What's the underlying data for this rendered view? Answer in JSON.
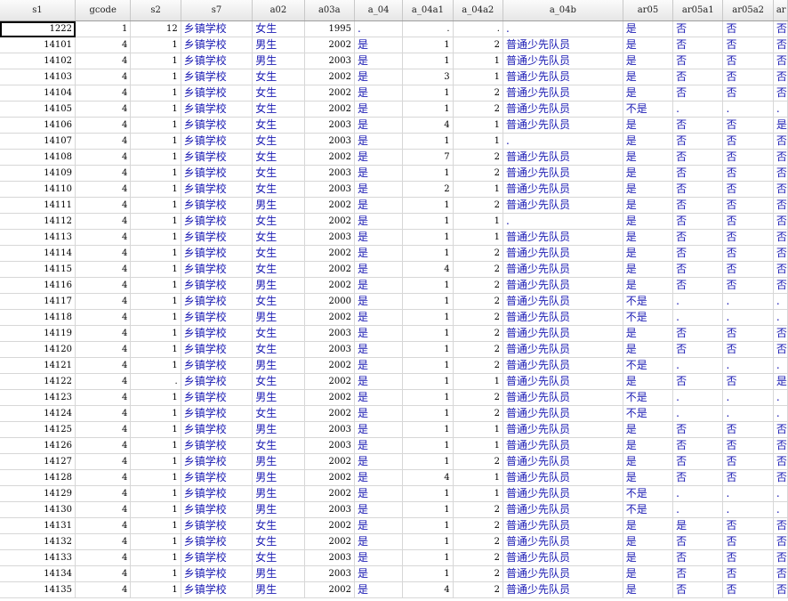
{
  "columns": [
    "s1",
    "gcode",
    "s2",
    "s7",
    "a02",
    "a03a",
    "a_04",
    "a_04a1",
    "a_04a2",
    "a_04b",
    "ar05",
    "ar05a1",
    "ar05a2",
    "ar"
  ],
  "rows": [
    [
      "1222",
      "1",
      "12",
      "乡镇学校",
      "女生",
      "1995",
      ".",
      ".",
      ".",
      ".",
      "是",
      "否",
      "否",
      "否"
    ],
    [
      "14101",
      "4",
      "1",
      "乡镇学校",
      "男生",
      "2002",
      "是",
      "1",
      "2",
      "普通少先队员",
      "是",
      "否",
      "否",
      "否"
    ],
    [
      "14102",
      "4",
      "1",
      "乡镇学校",
      "男生",
      "2003",
      "是",
      "1",
      "1",
      "普通少先队员",
      "是",
      "否",
      "否",
      "否"
    ],
    [
      "14103",
      "4",
      "1",
      "乡镇学校",
      "女生",
      "2002",
      "是",
      "3",
      "1",
      "普通少先队员",
      "是",
      "否",
      "否",
      "否"
    ],
    [
      "14104",
      "4",
      "1",
      "乡镇学校",
      "女生",
      "2002",
      "是",
      "1",
      "2",
      "普通少先队员",
      "是",
      "否",
      "否",
      "否"
    ],
    [
      "14105",
      "4",
      "1",
      "乡镇学校",
      "女生",
      "2002",
      "是",
      "1",
      "2",
      "普通少先队员",
      "不是",
      ".",
      ".",
      "."
    ],
    [
      "14106",
      "4",
      "1",
      "乡镇学校",
      "女生",
      "2003",
      "是",
      "4",
      "1",
      "普通少先队员",
      "是",
      "否",
      "否",
      "是"
    ],
    [
      "14107",
      "4",
      "1",
      "乡镇学校",
      "女生",
      "2003",
      "是",
      "1",
      "1",
      ".",
      "是",
      "否",
      "否",
      "否"
    ],
    [
      "14108",
      "4",
      "1",
      "乡镇学校",
      "女生",
      "2002",
      "是",
      "7",
      "2",
      "普通少先队员",
      "是",
      "否",
      "否",
      "否"
    ],
    [
      "14109",
      "4",
      "1",
      "乡镇学校",
      "女生",
      "2003",
      "是",
      "1",
      "2",
      "普通少先队员",
      "是",
      "否",
      "否",
      "否"
    ],
    [
      "14110",
      "4",
      "1",
      "乡镇学校",
      "女生",
      "2003",
      "是",
      "2",
      "1",
      "普通少先队员",
      "是",
      "否",
      "否",
      "否"
    ],
    [
      "14111",
      "4",
      "1",
      "乡镇学校",
      "男生",
      "2002",
      "是",
      "1",
      "2",
      "普通少先队员",
      "是",
      "否",
      "否",
      "否"
    ],
    [
      "14112",
      "4",
      "1",
      "乡镇学校",
      "女生",
      "2002",
      "是",
      "1",
      "1",
      ".",
      "是",
      "否",
      "否",
      "否"
    ],
    [
      "14113",
      "4",
      "1",
      "乡镇学校",
      "女生",
      "2003",
      "是",
      "1",
      "1",
      "普通少先队员",
      "是",
      "否",
      "否",
      "否"
    ],
    [
      "14114",
      "4",
      "1",
      "乡镇学校",
      "女生",
      "2002",
      "是",
      "1",
      "2",
      "普通少先队员",
      "是",
      "否",
      "否",
      "否"
    ],
    [
      "14115",
      "4",
      "1",
      "乡镇学校",
      "女生",
      "2002",
      "是",
      "4",
      "2",
      "普通少先队员",
      "是",
      "否",
      "否",
      "否"
    ],
    [
      "14116",
      "4",
      "1",
      "乡镇学校",
      "男生",
      "2002",
      "是",
      "1",
      "2",
      "普通少先队员",
      "是",
      "否",
      "否",
      "否"
    ],
    [
      "14117",
      "4",
      "1",
      "乡镇学校",
      "女生",
      "2000",
      "是",
      "1",
      "2",
      "普通少先队员",
      "不是",
      ".",
      ".",
      "."
    ],
    [
      "14118",
      "4",
      "1",
      "乡镇学校",
      "男生",
      "2002",
      "是",
      "1",
      "2",
      "普通少先队员",
      "不是",
      ".",
      ".",
      "."
    ],
    [
      "14119",
      "4",
      "1",
      "乡镇学校",
      "女生",
      "2003",
      "是",
      "1",
      "2",
      "普通少先队员",
      "是",
      "否",
      "否",
      "否"
    ],
    [
      "14120",
      "4",
      "1",
      "乡镇学校",
      "女生",
      "2003",
      "是",
      "1",
      "2",
      "普通少先队员",
      "是",
      "否",
      "否",
      "否"
    ],
    [
      "14121",
      "4",
      "1",
      "乡镇学校",
      "男生",
      "2002",
      "是",
      "1",
      "2",
      "普通少先队员",
      "不是",
      ".",
      ".",
      "."
    ],
    [
      "14122",
      "4",
      ".",
      "乡镇学校",
      "女生",
      "2002",
      "是",
      "1",
      "1",
      "普通少先队员",
      "是",
      "否",
      "否",
      "是"
    ],
    [
      "14123",
      "4",
      "1",
      "乡镇学校",
      "男生",
      "2002",
      "是",
      "1",
      "2",
      "普通少先队员",
      "不是",
      ".",
      ".",
      "."
    ],
    [
      "14124",
      "4",
      "1",
      "乡镇学校",
      "女生",
      "2002",
      "是",
      "1",
      "2",
      "普通少先队员",
      "不是",
      ".",
      ".",
      "."
    ],
    [
      "14125",
      "4",
      "1",
      "乡镇学校",
      "男生",
      "2003",
      "是",
      "1",
      "1",
      "普通少先队员",
      "是",
      "否",
      "否",
      "否"
    ],
    [
      "14126",
      "4",
      "1",
      "乡镇学校",
      "女生",
      "2003",
      "是",
      "1",
      "1",
      "普通少先队员",
      "是",
      "否",
      "否",
      "否"
    ],
    [
      "14127",
      "4",
      "1",
      "乡镇学校",
      "男生",
      "2002",
      "是",
      "1",
      "2",
      "普通少先队员",
      "是",
      "否",
      "否",
      "否"
    ],
    [
      "14128",
      "4",
      "1",
      "乡镇学校",
      "男生",
      "2002",
      "是",
      "4",
      "1",
      "普通少先队员",
      "是",
      "否",
      "否",
      "否"
    ],
    [
      "14129",
      "4",
      "1",
      "乡镇学校",
      "男生",
      "2002",
      "是",
      "1",
      "1",
      "普通少先队员",
      "不是",
      ".",
      ".",
      "."
    ],
    [
      "14130",
      "4",
      "1",
      "乡镇学校",
      "男生",
      "2003",
      "是",
      "1",
      "2",
      "普通少先队员",
      "不是",
      ".",
      ".",
      "."
    ],
    [
      "14131",
      "4",
      "1",
      "乡镇学校",
      "女生",
      "2002",
      "是",
      "1",
      "2",
      "普通少先队员",
      "是",
      "是",
      "否",
      "否"
    ],
    [
      "14132",
      "4",
      "1",
      "乡镇学校",
      "女生",
      "2002",
      "是",
      "1",
      "2",
      "普通少先队员",
      "是",
      "否",
      "否",
      "否"
    ],
    [
      "14133",
      "4",
      "1",
      "乡镇学校",
      "女生",
      "2003",
      "是",
      "1",
      "2",
      "普通少先队员",
      "是",
      "否",
      "否",
      "否"
    ],
    [
      "14134",
      "4",
      "1",
      "乡镇学校",
      "男生",
      "2003",
      "是",
      "1",
      "2",
      "普通少先队员",
      "是",
      "否",
      "否",
      "否"
    ],
    [
      "14135",
      "4",
      "1",
      "乡镇学校",
      "男生",
      "2002",
      "是",
      "4",
      "2",
      "普通少先队员",
      "是",
      "否",
      "否",
      "否"
    ]
  ],
  "selected_cell": {
    "row": 0,
    "col": 0
  }
}
